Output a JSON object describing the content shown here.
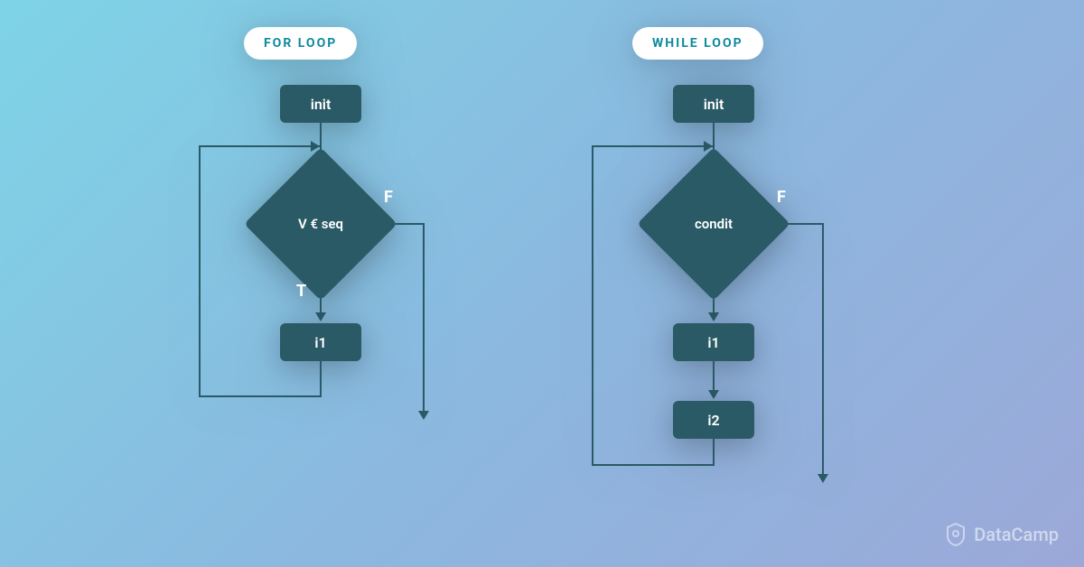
{
  "for_loop": {
    "title": "FOR LOOP",
    "init": "init",
    "decision": "V € seq",
    "true_label": "T",
    "false_label": "F",
    "body": "i1"
  },
  "while_loop": {
    "title": "WHILE LOOP",
    "init": "init",
    "decision": "condit",
    "false_label": "F",
    "body1": "i1",
    "body2": "i2"
  },
  "brand": "DataCamp",
  "colors": {
    "node": "#2a5a66",
    "accent": "#0e8a9e"
  }
}
